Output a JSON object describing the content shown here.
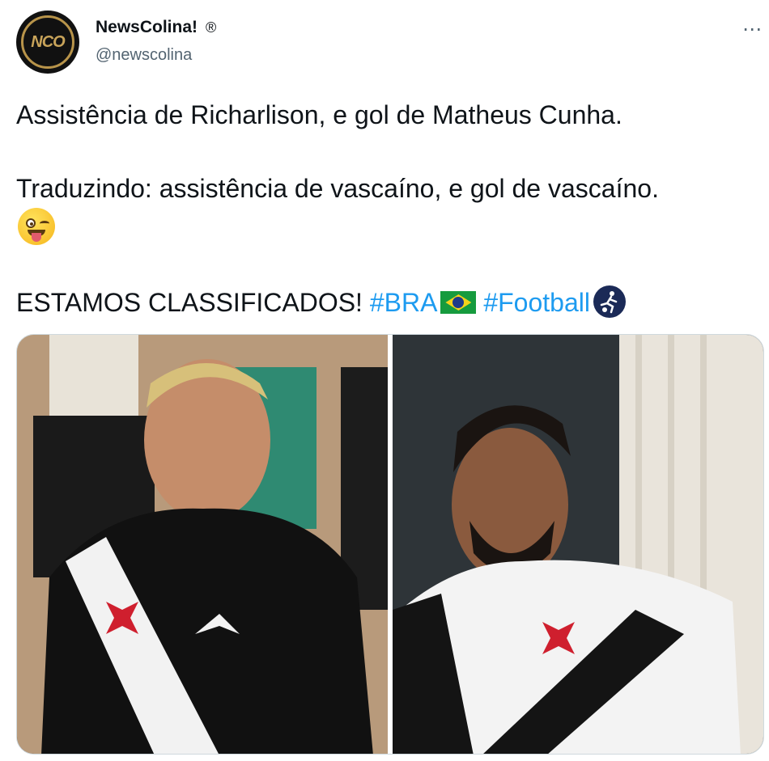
{
  "tweet": {
    "author": {
      "display_name": "NewsColina!",
      "registered_mark": "®",
      "handle": "@newscolina",
      "avatar_text": "NCO"
    },
    "more_icon": "⋯",
    "lines": {
      "line1": "Assistência de Richarlison, e gol de Matheus Cunha.",
      "line2": "Traduzindo: assistência de vascaíno, e gol de vascaíno.",
      "line3_text": "ESTAMOS CLASSIFICADOS! ",
      "hashtag1": "#BRA",
      "hashtag2": "#Football"
    },
    "emoji": "winking-face-with-tongue",
    "icons": [
      "brazil-flag-icon",
      "football-icon",
      "more-icon"
    ],
    "media": {
      "images": [
        {
          "description_name": "richarlison-photo"
        },
        {
          "description_name": "matheus-cunha-photo"
        }
      ]
    },
    "colors": {
      "link": "#1d9bf0",
      "text": "#0f1419",
      "secondary": "#536471"
    }
  }
}
